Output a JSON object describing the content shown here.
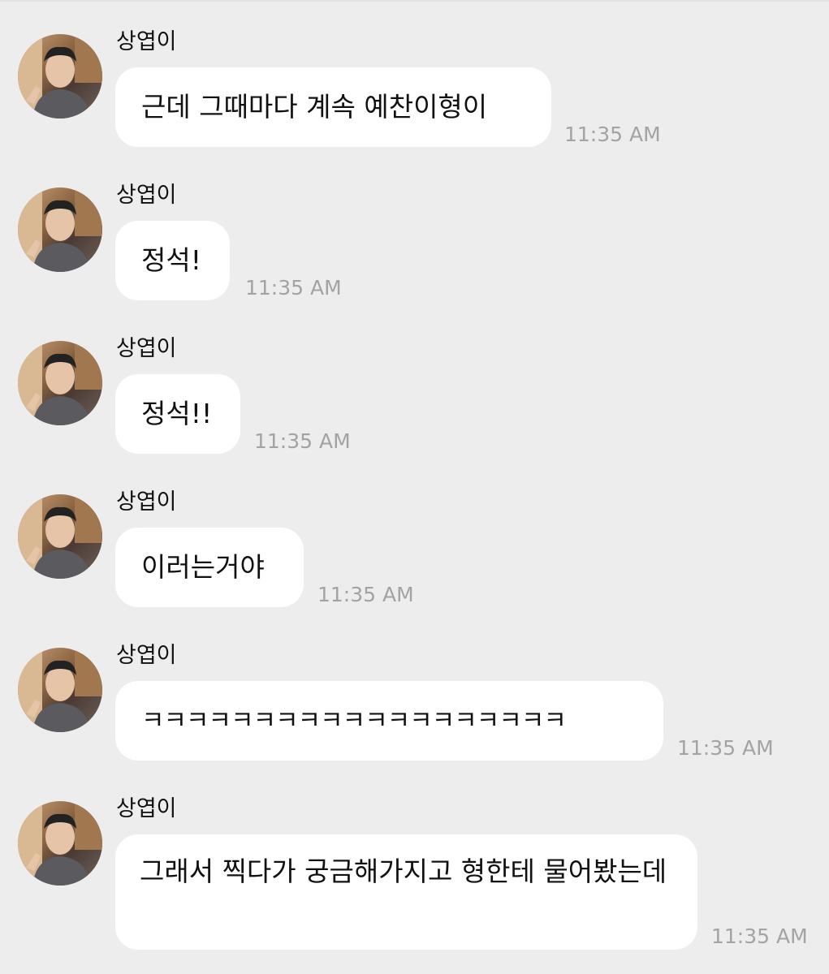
{
  "messages": [
    {
      "sender": "상엽이",
      "text": "근데 그때마다 계속 예찬이형이",
      "time": "11:35 AM"
    },
    {
      "sender": "상엽이",
      "text": "정석!",
      "time": "11:35 AM"
    },
    {
      "sender": "상엽이",
      "text": "정석!!",
      "time": "11:35 AM"
    },
    {
      "sender": "상엽이",
      "text": "이러는거야",
      "time": "11:35 AM"
    },
    {
      "sender": "상엽이",
      "text": "ㅋㅋㅋㅋㅋㅋㅋㅋㅋㅋㅋㅋㅋㅋㅋㅋㅋㅋㅋ",
      "time": "11:35 AM"
    },
    {
      "sender": "상엽이",
      "text": "그래서 찍다가 궁금해가지고 형한테 물어봤는데",
      "time": "11:35 AM"
    }
  ],
  "colors": {
    "background": "#ededed",
    "bubble": "#ffffff",
    "text": "#111111",
    "timestamp": "#a3a3a3"
  }
}
